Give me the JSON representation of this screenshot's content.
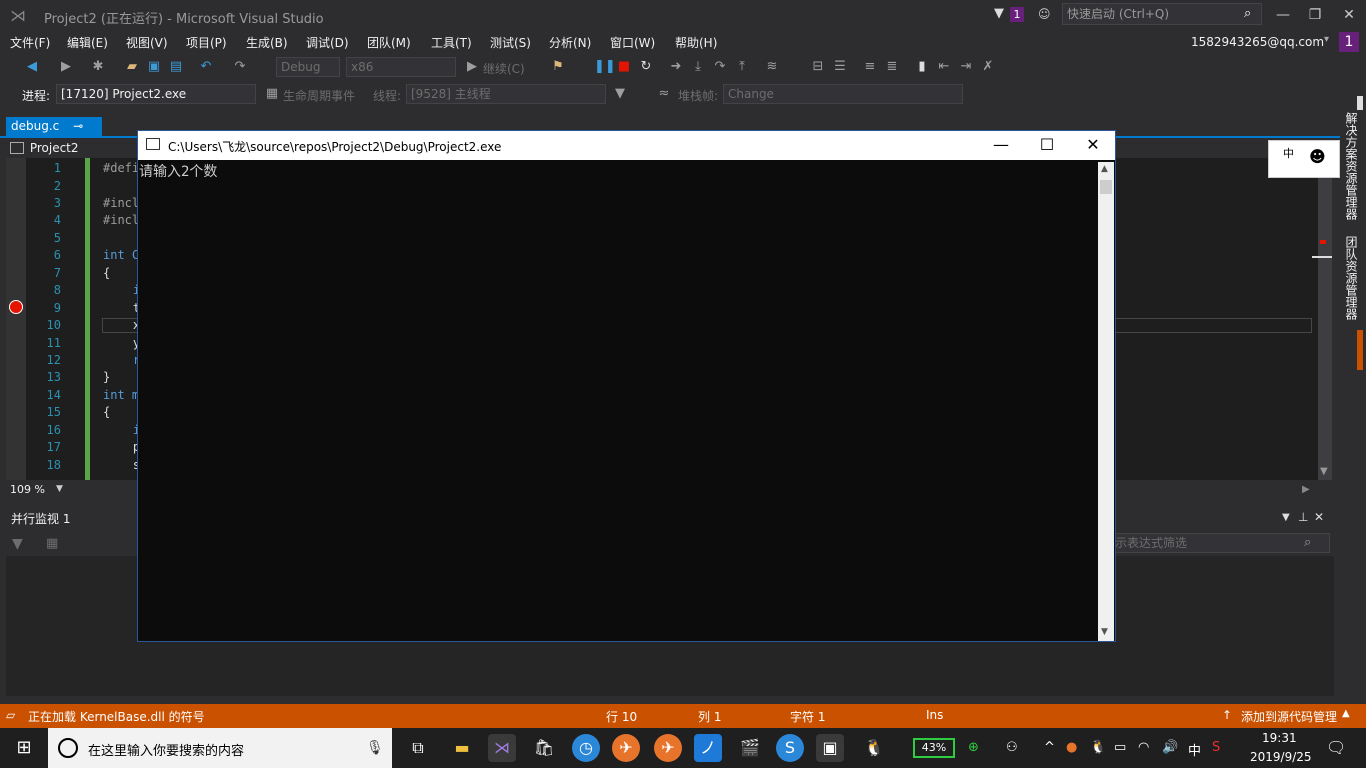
{
  "titlebar": {
    "title": "Project2 (正在运行) - Microsoft Visual Studio",
    "notification_count": "1",
    "quick_launch_placeholder": "快速启动 (Ctrl+Q)"
  },
  "menu": [
    "文件(F)",
    "编辑(E)",
    "视图(V)",
    "项目(P)",
    "生成(B)",
    "调试(D)",
    "团队(M)",
    "工具(T)",
    "测试(S)",
    "分析(N)",
    "窗口(W)",
    "帮助(H)"
  ],
  "account": {
    "email": "1582943265@qq.com",
    "badge": "1"
  },
  "toolbar": {
    "config": "Debug",
    "platform": "x86",
    "continue_label": "继续(C)",
    "process_label": "进程:",
    "process_value": "[17120] Project2.exe",
    "lifecycle_label": "生命周期事件",
    "thread_label": "线程:",
    "thread_value": "[9528] 主线程",
    "stack_label": "堆栈帧:",
    "stack_value": "Change"
  },
  "editor": {
    "tab_name": "debug.c",
    "nav_project": "Project2",
    "zoom": "109 %",
    "lines": [
      {
        "n": "1",
        "code": "#defi"
      },
      {
        "n": "2",
        "code": ""
      },
      {
        "n": "3",
        "code": "#incl"
      },
      {
        "n": "4",
        "code": "#incl"
      },
      {
        "n": "5",
        "code": ""
      },
      {
        "n": "6",
        "code": "int C"
      },
      {
        "n": "7",
        "code": "{"
      },
      {
        "n": "8",
        "code": "    i"
      },
      {
        "n": "9",
        "code": "    t"
      },
      {
        "n": "10",
        "code": "    x"
      },
      {
        "n": "11",
        "code": "    y"
      },
      {
        "n": "12",
        "code": "    r"
      },
      {
        "n": "13",
        "code": "}"
      },
      {
        "n": "14",
        "code": "int m"
      },
      {
        "n": "15",
        "code": "{"
      },
      {
        "n": "16",
        "code": "    i"
      },
      {
        "n": "17",
        "code": "    p"
      },
      {
        "n": "18",
        "code": "    s"
      }
    ]
  },
  "parallel_watch": {
    "title": "并行监视 1",
    "filter_placeholder": "示表达式筛选"
  },
  "console": {
    "title": "C:\\Users\\飞龙\\source\\repos\\Project2\\Debug\\Project2.exe",
    "output": "请输入2个数"
  },
  "right_panel": {
    "tab1": "解决方案资源管理器",
    "tab2": "团队资源管理器",
    "ime_char": "中"
  },
  "statusbar": {
    "message": "正在加载 KernelBase.dll 的符号",
    "line": "行 10",
    "col": "列 1",
    "char": "字符 1",
    "mode": "Ins",
    "source_control": "添加到源代码管理"
  },
  "taskbar": {
    "search_placeholder": "在这里输入你要搜索的内容",
    "battery": "43%",
    "ime": "中",
    "time": "19:31",
    "date": "2019/9/25"
  },
  "colors": {
    "accent": "#007acc",
    "status_bar": "#ca5100",
    "badge": "#68217a",
    "breakpoint": "#e51400"
  }
}
